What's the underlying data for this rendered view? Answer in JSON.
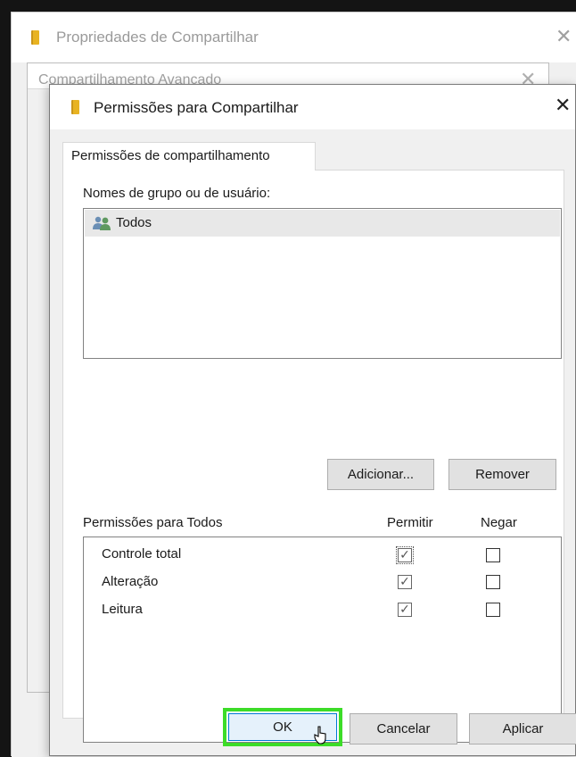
{
  "back_window": {
    "title": "Propriedades de Compartilhar"
  },
  "mid_window": {
    "title": "Compartilhamento Avançado"
  },
  "dialog": {
    "title": "Permissões para Compartilhar",
    "tab_label": "Permissões de compartilhamento",
    "group_label": "Nomes de grupo ou de usuário:",
    "users": [
      {
        "name": "Todos",
        "icon": "users-group-icon"
      }
    ],
    "add_button": "Adicionar...",
    "remove_button": "Remover",
    "permissions_for_label": "Permissões para Todos",
    "allow_header": "Permitir",
    "deny_header": "Negar",
    "permissions": [
      {
        "name": "Controle total",
        "allow": true,
        "deny": false
      },
      {
        "name": "Alteração",
        "allow": true,
        "deny": false
      },
      {
        "name": "Leitura",
        "allow": true,
        "deny": false
      }
    ],
    "ok_button": "OK",
    "cancel_button": "Cancelar",
    "apply_button": "Aplicar"
  },
  "colors": {
    "ok_highlight": "#3cdc28",
    "selected_row": "#e8e8e8",
    "folder": "#e8b322"
  }
}
